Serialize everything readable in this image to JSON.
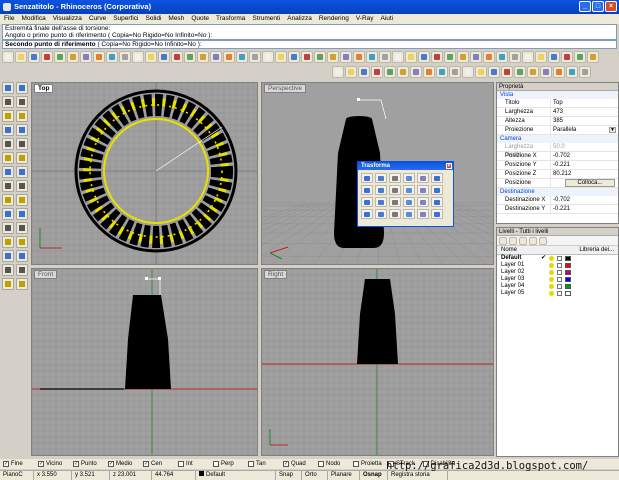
{
  "window": {
    "title": "Senzatitolo - Rhinoceros (Corporativa)"
  },
  "menu": [
    "File",
    "Modifica",
    "Visualizza",
    "Curve",
    "Superfici",
    "Solidi",
    "Mesh",
    "Quote",
    "Trasforma",
    "Strumenti",
    "Analizza",
    "Rendering",
    "V-Ray",
    "Aiuti"
  ],
  "command": {
    "history1": "Estremità finale dell'asse di torsione:",
    "history2": "Angolo o primo punto di riferimento ( Copia=No  Rigido=No  Infinito=No ):",
    "prompt": "Secondo punto di riferimento",
    "options": " ( Copia=No  Rigido=No  Infinito=No ):"
  },
  "viewports": {
    "top": "Top",
    "perspective": "Perspective",
    "front": "Front",
    "right": "Right"
  },
  "properties": {
    "header": "Proprietà",
    "section_vista": "Vista",
    "rows_vista": [
      {
        "key": "Titolo",
        "value": "Top"
      },
      {
        "key": "Larghezza",
        "value": "473"
      },
      {
        "key": "Altezza",
        "value": "385"
      },
      {
        "key": "Proiezione",
        "value": "Parallela"
      }
    ],
    "section_camera": "Camera",
    "rows_camera": [
      {
        "key": "Larghezza focale",
        "value": "50.0"
      },
      {
        "key": "Posizione X",
        "value": "-0.702"
      },
      {
        "key": "Posizione Y",
        "value": "-0.221"
      },
      {
        "key": "Posizione Z",
        "value": "80.212"
      },
      {
        "key": "Posizione",
        "value": "Colloca..."
      }
    ],
    "section_dest": "Destinazione",
    "rows_dest": [
      {
        "key": "Destinazione X",
        "value": "-0.702"
      },
      {
        "key": "Destinazione Y",
        "value": "-0.221"
      }
    ]
  },
  "layers": {
    "header": "Livelli - Tutti i livelli",
    "col_name": "Nome",
    "col_lib": "Libreria dei...",
    "rows": [
      {
        "name": "Default",
        "current": "✔",
        "color": "#000000"
      },
      {
        "name": "Layer 01",
        "current": "",
        "color": "#ff0000"
      },
      {
        "name": "Layer 02",
        "current": "",
        "color": "#c00080"
      },
      {
        "name": "Layer 03",
        "current": "",
        "color": "#0000ff"
      },
      {
        "name": "Layer 04",
        "current": "",
        "color": "#00a000"
      },
      {
        "name": "Layer 05",
        "current": "",
        "color": "#ffffff"
      }
    ]
  },
  "trasforma": {
    "title": "Trasforma"
  },
  "osnap": [
    {
      "label": "Fine",
      "checked": true
    },
    {
      "label": "Vicino",
      "checked": true
    },
    {
      "label": "Punto",
      "checked": true
    },
    {
      "label": "Medio",
      "checked": true
    },
    {
      "label": "Cen",
      "checked": true
    },
    {
      "label": "Int",
      "checked": false
    },
    {
      "label": "Perp",
      "checked": false
    },
    {
      "label": "Tan",
      "checked": false
    },
    {
      "label": "Quad",
      "checked": true
    },
    {
      "label": "Nodo",
      "checked": false
    },
    {
      "label": "Proietta",
      "checked": false
    },
    {
      "label": "STrack",
      "checked": false
    },
    {
      "label": "Disabilita",
      "checked": false
    }
  ],
  "status": {
    "cplane": "PianoC",
    "x": "x 3.550",
    "y": "y 3.521",
    "z": "z 23.001",
    "dist": "44.764",
    "layer": "Default",
    "snap": "Snap",
    "orto": "Orto",
    "planare": "Planare",
    "osnap": "Osnap",
    "history": "Registra storia"
  },
  "watermark": "http://grafica2d3d.blogspot.com/",
  "colors": {
    "axis_x": "#c00000",
    "axis_y": "#008000",
    "grid": "#8a8a8a",
    "selection": "#e8e000"
  }
}
